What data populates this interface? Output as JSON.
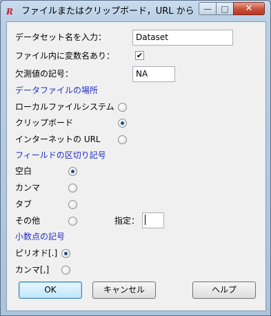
{
  "window": {
    "title": "ファイルまたはクリップボード，URL から...",
    "app_icon_glyph": "R",
    "minimize_glyph": "—",
    "maximize_glyph": "□",
    "close_glyph": "✕"
  },
  "form": {
    "dataset_name_label": "データセット名を入力：",
    "dataset_name_value": "Dataset",
    "var_names_label": "ファイル内に変数名あり：",
    "var_names_checked": true,
    "var_names_check_glyph": "✔",
    "missing_label": "欠測値の記号：",
    "missing_value": "NA"
  },
  "location": {
    "heading": "データファイルの場所",
    "options": [
      {
        "label": "ローカルファイルシステム",
        "selected": false
      },
      {
        "label": "クリップボード",
        "selected": true
      },
      {
        "label": "インターネットの URL",
        "selected": false
      }
    ]
  },
  "separator": {
    "heading": "フィールドの区切り記号",
    "options": [
      {
        "label": "空白",
        "selected": true
      },
      {
        "label": "カンマ",
        "selected": false
      },
      {
        "label": "タブ",
        "selected": false
      },
      {
        "label": "その他",
        "selected": false
      }
    ],
    "specify_label": "指定：",
    "specify_value": ""
  },
  "decimal": {
    "heading": "小数点の記号",
    "options": [
      {
        "label": "ピリオド[.]",
        "selected": true
      },
      {
        "label": "カンマ[,]",
        "selected": false
      }
    ]
  },
  "buttons": {
    "ok": "OK",
    "cancel": "キャンセル",
    "help": "ヘルプ"
  }
}
